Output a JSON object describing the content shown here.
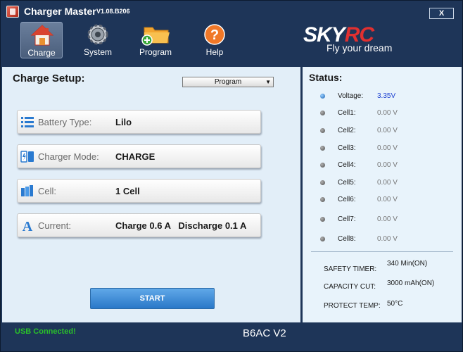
{
  "app": {
    "title": "Charger Master",
    "version": "V1.08.B206",
    "close_label": "X"
  },
  "toolbar": {
    "items": [
      {
        "label": "Charge",
        "icon": "house-icon",
        "active": true
      },
      {
        "label": "System",
        "icon": "gear-icon",
        "active": false
      },
      {
        "label": "Program",
        "icon": "folder-add-icon",
        "active": false
      },
      {
        "label": "Help",
        "icon": "question-icon",
        "active": false
      }
    ]
  },
  "brand": {
    "logo_sky": "SKY",
    "logo_rc": "RC",
    "slogan": "Fly your dream"
  },
  "charge_setup": {
    "title": "Charge Setup:",
    "program_select": "Program",
    "rows": [
      {
        "label": "Battery Type:",
        "value": "Lilo",
        "icon": "list-icon"
      },
      {
        "label": "Charger Mode:",
        "value": "CHARGE",
        "icon": "battery-mode-icon"
      },
      {
        "label": "Cell:",
        "value": "1 Cell",
        "icon": "cells-icon"
      },
      {
        "label": "Current:",
        "value": "Charge 0.6 A   Discharge 0.1 A",
        "icon": "current-icon"
      }
    ],
    "start_label": "START"
  },
  "status": {
    "title": "Status:",
    "rows": [
      {
        "label": "Voltage:",
        "value": "3.35V",
        "active": true
      },
      {
        "label": "Cell1:",
        "value": "0.00 V",
        "active": false
      },
      {
        "label": "Cell2:",
        "value": "0.00 V",
        "active": false
      },
      {
        "label": "Cell3:",
        "value": "0.00 V",
        "active": false
      },
      {
        "label": "Cell4:",
        "value": "0.00 V",
        "active": false
      },
      {
        "label": "Cell5:",
        "value": "0.00 V",
        "active": false
      },
      {
        "label": "Cell6:",
        "value": "0.00 V",
        "active": false
      },
      {
        "label": "Cell7:",
        "value": "0.00 V",
        "active": false
      },
      {
        "label": "Cell8:",
        "value": "0.00 V",
        "active": false
      }
    ],
    "safety_timer_label": "SAFETY TIMER:",
    "safety_timer_value": "340 Min(ON)",
    "capacity_cut_label": "CAPACITY CUT:",
    "capacity_cut_value": "3000 mAh(ON)",
    "protect_temp_label": "PROTECT TEMP:",
    "protect_temp_value": "50°C"
  },
  "footer": {
    "usb_status": "USB  Connected!",
    "model": "B6AC V2"
  },
  "colors": {
    "window_bg": "#1e3558",
    "accent_blue": "#2a78c8",
    "usb_green": "#2ac02a",
    "brand_red": "#e03030",
    "voltage_blue": "#1a3ed0"
  }
}
